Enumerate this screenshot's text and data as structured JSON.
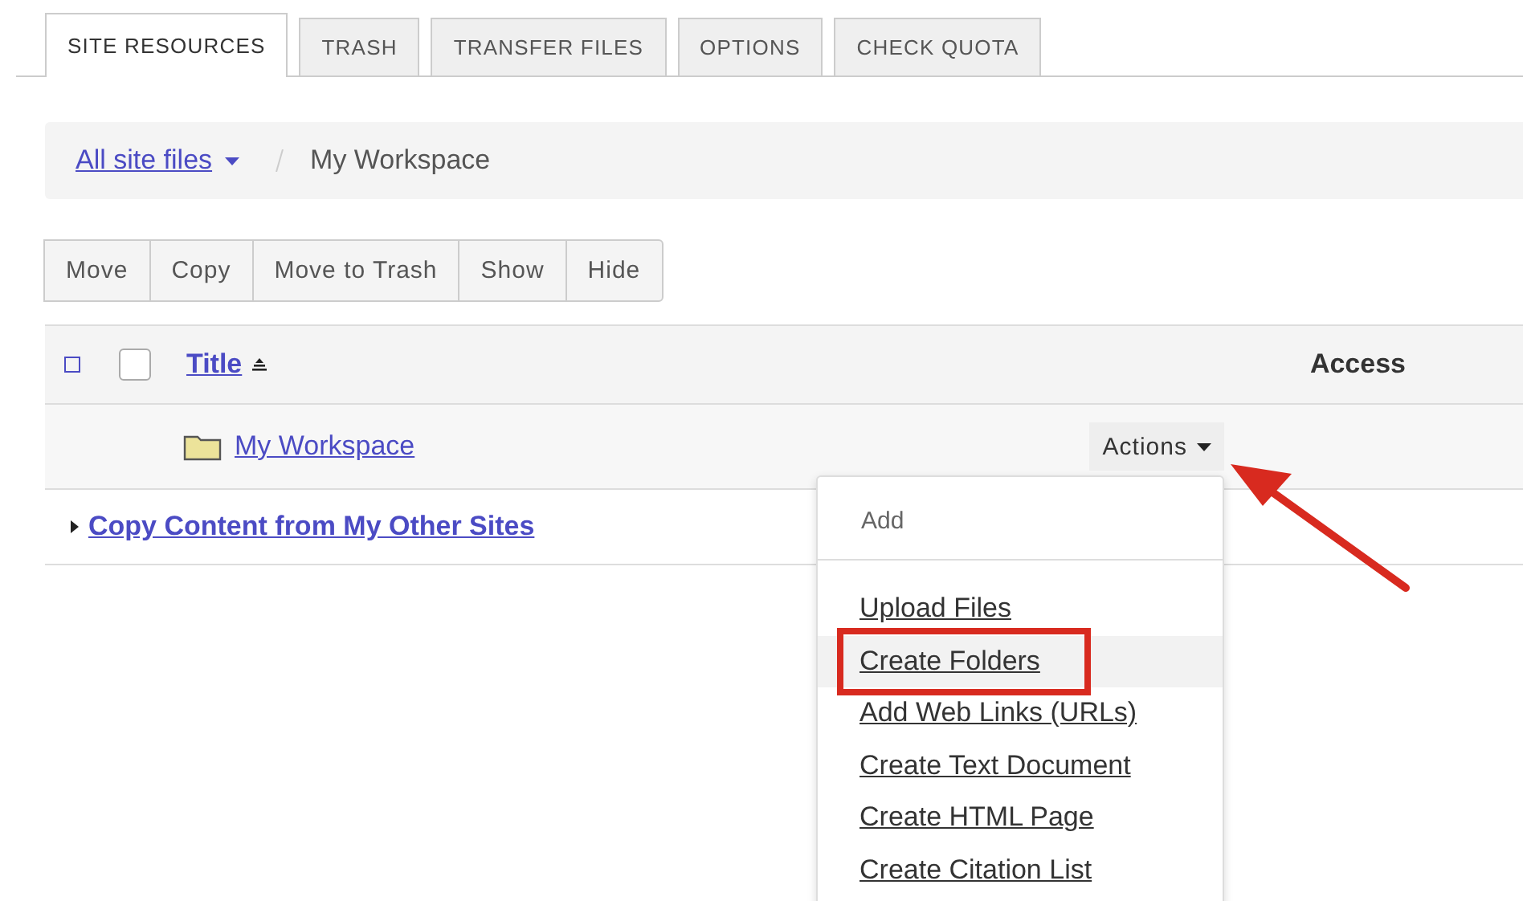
{
  "tabs": [
    {
      "label": "SITE RESOURCES",
      "selected": true
    },
    {
      "label": "TRASH",
      "selected": false
    },
    {
      "label": "TRANSFER FILES",
      "selected": false
    },
    {
      "label": "OPTIONS",
      "selected": false
    },
    {
      "label": "CHECK QUOTA",
      "selected": false
    }
  ],
  "breadcrumb": {
    "root": "All site files",
    "current": "My Workspace"
  },
  "toolbar": [
    "Move",
    "Copy",
    "Move to Trash",
    "Show",
    "Hide"
  ],
  "table": {
    "columns": {
      "title": "Title",
      "access": "Access"
    },
    "select_all_checked": false,
    "checkbox_checked": false,
    "rows": [
      {
        "kind": "folder",
        "title": "My Workspace",
        "actions": "Actions"
      },
      {
        "kind": "expander",
        "title": "Copy Content from My Other Sites",
        "expanded": false
      }
    ]
  },
  "actions_menu": {
    "header": "Add",
    "items": [
      {
        "label": "Upload Files",
        "selected": false
      },
      {
        "label": "Create Folders",
        "selected": true
      },
      {
        "label": "Add Web Links (URLs)",
        "selected": false
      },
      {
        "label": "Create Text Document",
        "selected": false
      },
      {
        "label": "Create HTML Page",
        "selected": false
      },
      {
        "label": "Create Citation List",
        "selected": false
      }
    ]
  },
  "annotations": {
    "highlight_box": true,
    "pointer_arrow": true
  }
}
